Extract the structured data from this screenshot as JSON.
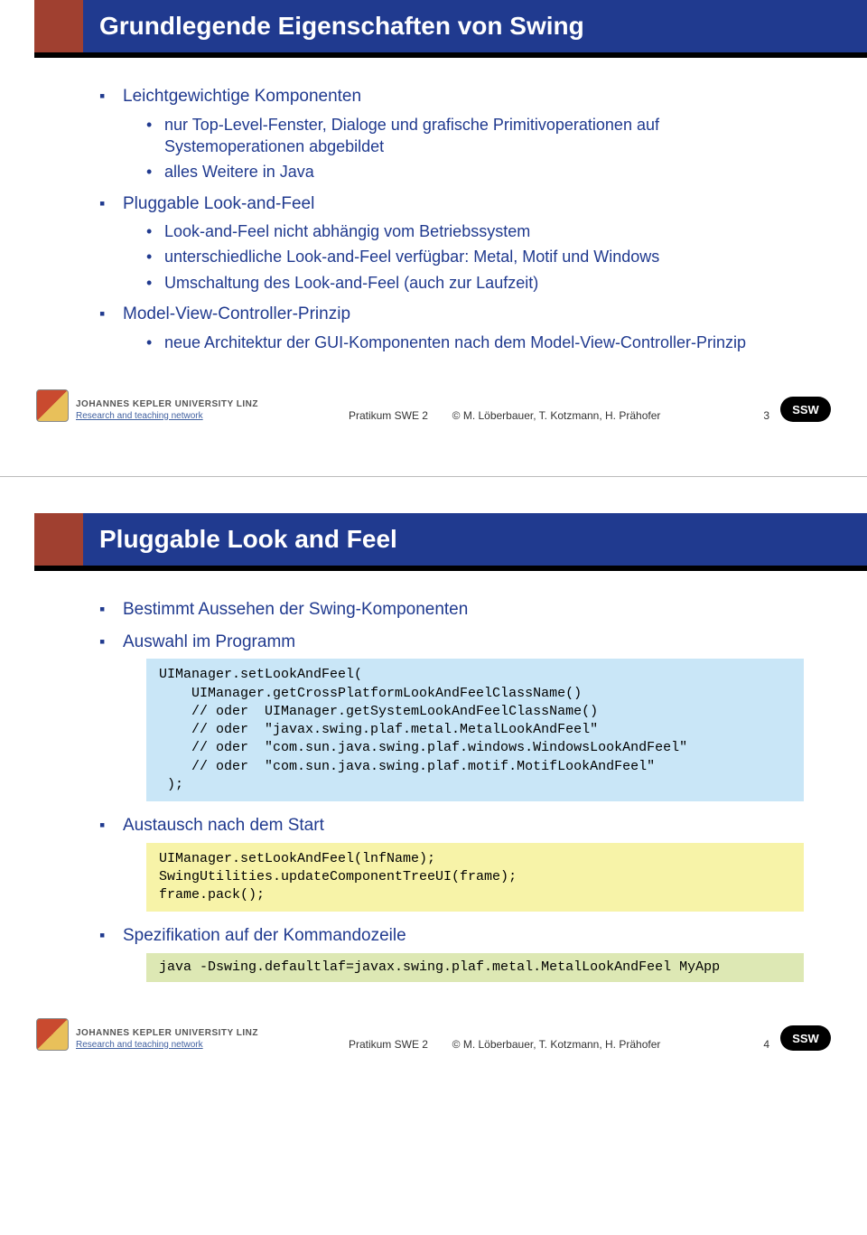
{
  "slide1": {
    "title": "Grundlegende Eigenschaften von Swing",
    "items": [
      {
        "label": "Leichtgewichtige Komponenten",
        "sub": [
          "nur Top-Level-Fenster, Dialoge und grafische Primitivoperationen auf Systemoperationen abgebildet",
          "alles Weitere in Java"
        ]
      },
      {
        "label": "Pluggable Look-and-Feel",
        "sub": [
          "Look-and-Feel nicht abhängig vom Betriebssystem",
          "unterschiedliche Look-and-Feel verfügbar: Metal, Motif und Windows",
          "Umschaltung des Look-and-Feel (auch zur Laufzeit)"
        ]
      },
      {
        "label": "Model-View-Controller-Prinzip",
        "sub": [
          "neue Architektur der GUI-Komponenten nach dem Model-View-Controller-Prinzip"
        ]
      }
    ],
    "page": "3"
  },
  "slide2": {
    "title": "Pluggable Look and Feel",
    "b1": "Bestimmt Aussehen der Swing-Komponenten",
    "b2": "Auswahl im Programm",
    "code1": "UIManager.setLookAndFeel(\n    UIManager.getCrossPlatformLookAndFeelClassName()\n    // oder  UIManager.getSystemLookAndFeelClassName()\n    // oder  \"javax.swing.plaf.metal.MetalLookAndFeel\"\n    // oder  \"com.sun.java.swing.plaf.windows.WindowsLookAndFeel\"\n    // oder  \"com.sun.java.swing.plaf.motif.MotifLookAndFeel\"\n );",
    "b3": "Austausch nach dem Start",
    "code2": "UIManager.setLookAndFeel(lnfName);\nSwingUtilities.updateComponentTreeUI(frame);\nframe.pack();",
    "b4": "Spezifikation auf der Kommandozeile",
    "code3": "java -Dswing.defaultlaf=javax.swing.plaf.metal.MetalLookAndFeel MyApp",
    "page": "4"
  },
  "footer": {
    "uni": "JOHANNES KEPLER UNIVERSITY LINZ",
    "sub": "Research and teaching network",
    "course": "Pratikum SWE 2",
    "authors": "© M. Löberbauer, T. Kotzmann, H. Prähofer",
    "ssw": "SSW"
  }
}
